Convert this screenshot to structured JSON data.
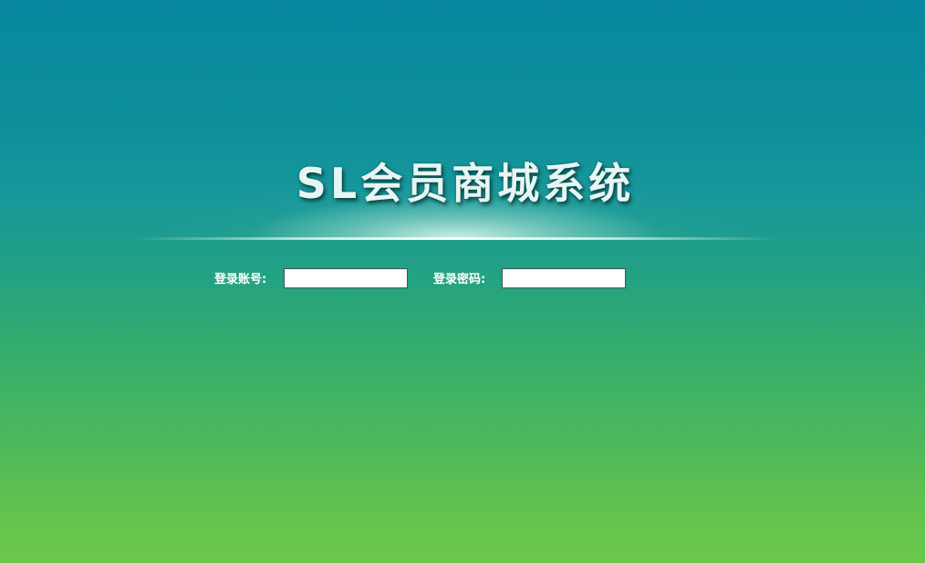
{
  "page": {
    "title": "SL会员商城系统"
  },
  "login": {
    "account_label": "登录账号:",
    "account_value": "",
    "password_label": "登录密码:",
    "password_value": ""
  },
  "colors": {
    "top": "#05879f",
    "middle": "#21a083",
    "bottom": "#6ac84a",
    "title_text": "#e6f6f3",
    "label_text": "#ffffff"
  }
}
